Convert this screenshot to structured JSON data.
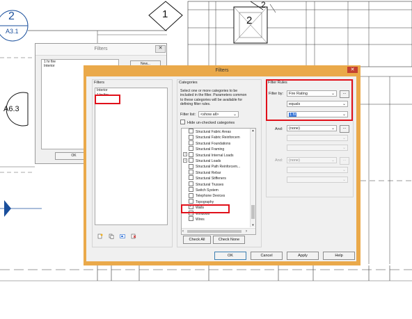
{
  "cad": {
    "tag_top_num": "2",
    "tag_top_ref": "A3.1",
    "tag_side": "A6.3",
    "diamond_label": "1",
    "box_label": "2",
    "box_label_top": "2"
  },
  "back_dialog": {
    "title": "Filters",
    "items": [
      "1 hr fire",
      "Interior"
    ],
    "new_label": "New...",
    "ok_label": "OK"
  },
  "dialog": {
    "title": "Filters",
    "close_glyph": "✕",
    "filters": {
      "heading": "Filters",
      "items": [
        "Interior",
        "1 hr fire"
      ]
    },
    "categories": {
      "heading": "Categories",
      "description": "Select one or more categories to be included in the filter.  Parameters common to these categories will be available for defining filter rules.",
      "filter_list_label": "Filter list:",
      "filter_list_value": "<show all>",
      "hide_unchecked_label": "Hide un-checked categories",
      "items": [
        {
          "label": "Structural Fabric Areas",
          "expander": "",
          "checked": false
        },
        {
          "label": "Structural Fabric Reinforcem",
          "expander": "",
          "checked": false
        },
        {
          "label": "Structural Foundations",
          "expander": "",
          "checked": false
        },
        {
          "label": "Structural Framing",
          "expander": "",
          "checked": false
        },
        {
          "label": "Structural Internal Loads",
          "expander": "+",
          "checked": false
        },
        {
          "label": "Structural Loads",
          "expander": "+",
          "checked": false
        },
        {
          "label": "Structural Path Reinforcem...",
          "expander": "",
          "checked": false
        },
        {
          "label": "Structural Rebar",
          "expander": "",
          "checked": false
        },
        {
          "label": "Structural Stiffeners",
          "expander": "",
          "checked": false
        },
        {
          "label": "Structural Trusses",
          "expander": "",
          "checked": false
        },
        {
          "label": "Switch System",
          "expander": "",
          "checked": false
        },
        {
          "label": "Telephone Devices",
          "expander": "",
          "checked": false
        },
        {
          "label": "Topography",
          "expander": "",
          "checked": false
        },
        {
          "label": "Walls",
          "expander": "",
          "checked": true
        },
        {
          "label": "Windows",
          "expander": "",
          "checked": false
        },
        {
          "label": "Wires",
          "expander": "",
          "checked": false
        }
      ],
      "check_all_label": "Check All",
      "check_none_label": "Check None"
    },
    "filter_rules": {
      "heading": "Filter Rules",
      "filter_by_label": "Filter by:",
      "filter_by_value": "Fire Rating",
      "operator_value": "equals",
      "value": "1 hr",
      "and1_label": "And:",
      "and1_value": "(none)",
      "and2_label": "And:",
      "and2_value": "(none)",
      "ellipsis": "..."
    },
    "buttons": {
      "ok": "OK",
      "cancel": "Cancel",
      "apply": "Apply",
      "help": "Help"
    }
  },
  "colors": {
    "dialog_frame": "#eaa94a",
    "highlight_red": "#e0101a",
    "cad_blue": "#1a4f9c",
    "selection_blue": "#3b78d8"
  }
}
